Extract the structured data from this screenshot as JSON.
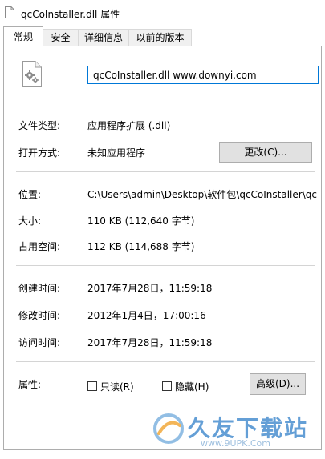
{
  "window": {
    "title": "qcCoInstaller.dll 属性"
  },
  "tabs": [
    {
      "label": "常规",
      "active": true
    },
    {
      "label": "安全",
      "active": false
    },
    {
      "label": "详细信息",
      "active": false
    },
    {
      "label": "以前的版本",
      "active": false
    }
  ],
  "general": {
    "file_name": "qcCoInstaller.dll www.downyi.com",
    "file_type_label": "文件类型:",
    "file_type_value": "应用程序扩展 (.dll)",
    "open_with_label": "打开方式:",
    "open_with_value": "未知应用程序",
    "change_button": "更改(C)...",
    "location_label": "位置:",
    "location_value": "C:\\Users\\admin\\Desktop\\软件包\\qcCoInstaller\\qc",
    "size_label": "大小:",
    "size_value": "110 KB (112,640 字节)",
    "size_on_disk_label": "占用空间:",
    "size_on_disk_value": "112 KB (114,688 字节)",
    "created_label": "创建时间:",
    "created_value": "2017年7月28日，11:59:18",
    "modified_label": "修改时间:",
    "modified_value": "2012年1月4日，17:00:16",
    "accessed_label": "访问时间:",
    "accessed_value": "2017年7月28日，11:59:18",
    "attributes_label": "属性:",
    "readonly_label": "只读(R)",
    "readonly_checked": false,
    "hidden_label": "隐藏(H)",
    "hidden_checked": false,
    "advanced_button": "高级(D)..."
  },
  "watermark": {
    "brand": "久友下载站",
    "url": "www.9UPK.Com"
  },
  "colors": {
    "focus_border": "#0078d7",
    "watermark": "#4a8fd0"
  }
}
